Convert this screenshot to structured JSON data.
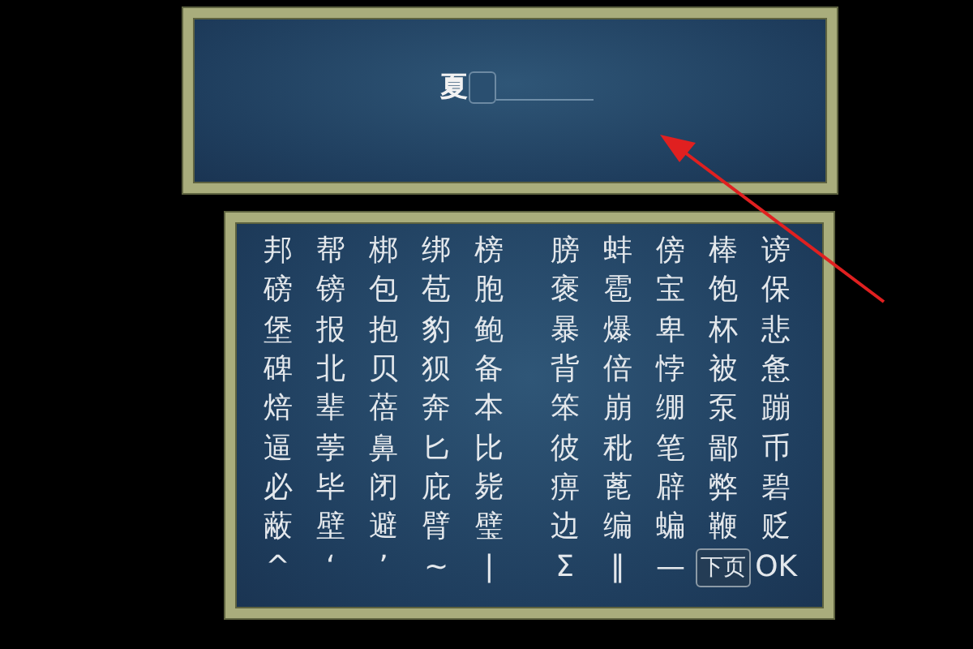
{
  "name_entry": {
    "value": "夏"
  },
  "keyboard": {
    "rows": [
      {
        "cells": [
          {
            "text": "邦",
            "selected": false
          },
          {
            "text": "帮",
            "selected": false
          },
          {
            "text": "梆",
            "selected": false
          },
          {
            "text": "绑",
            "selected": false
          },
          {
            "text": "榜",
            "selected": false
          },
          {
            "text": "膀",
            "selected": false
          },
          {
            "text": "蚌",
            "selected": false
          },
          {
            "text": "傍",
            "selected": false
          },
          {
            "text": "棒",
            "selected": false
          },
          {
            "text": "谤",
            "selected": false
          }
        ]
      },
      {
        "cells": [
          {
            "text": "磅",
            "selected": false
          },
          {
            "text": "镑",
            "selected": false
          },
          {
            "text": "包",
            "selected": false
          },
          {
            "text": "苞",
            "selected": false
          },
          {
            "text": "胞",
            "selected": false
          },
          {
            "text": "褒",
            "selected": false
          },
          {
            "text": "雹",
            "selected": false
          },
          {
            "text": "宝",
            "selected": false
          },
          {
            "text": "饱",
            "selected": false
          },
          {
            "text": "保",
            "selected": false
          }
        ]
      },
      {
        "cells": [
          {
            "text": "堡",
            "selected": false
          },
          {
            "text": "报",
            "selected": false
          },
          {
            "text": "抱",
            "selected": false
          },
          {
            "text": "豹",
            "selected": false
          },
          {
            "text": "鲍",
            "selected": false
          },
          {
            "text": "暴",
            "selected": false
          },
          {
            "text": "爆",
            "selected": false
          },
          {
            "text": "卑",
            "selected": false
          },
          {
            "text": "杯",
            "selected": false
          },
          {
            "text": "悲",
            "selected": false
          }
        ]
      },
      {
        "cells": [
          {
            "text": "碑",
            "selected": false
          },
          {
            "text": "北",
            "selected": false
          },
          {
            "text": "贝",
            "selected": false
          },
          {
            "text": "狈",
            "selected": false
          },
          {
            "text": "备",
            "selected": false
          },
          {
            "text": "背",
            "selected": false
          },
          {
            "text": "倍",
            "selected": false
          },
          {
            "text": "悖",
            "selected": false
          },
          {
            "text": "被",
            "selected": false
          },
          {
            "text": "惫",
            "selected": false
          }
        ]
      },
      {
        "cells": [
          {
            "text": "焙",
            "selected": false
          },
          {
            "text": "辈",
            "selected": false
          },
          {
            "text": "蓓",
            "selected": false
          },
          {
            "text": "奔",
            "selected": false
          },
          {
            "text": "本",
            "selected": false
          },
          {
            "text": "笨",
            "selected": false
          },
          {
            "text": "崩",
            "selected": false
          },
          {
            "text": "绷",
            "selected": false
          },
          {
            "text": "泵",
            "selected": false
          },
          {
            "text": "蹦",
            "selected": false
          }
        ]
      },
      {
        "cells": [
          {
            "text": "逼",
            "selected": false
          },
          {
            "text": "荸",
            "selected": false
          },
          {
            "text": "鼻",
            "selected": false
          },
          {
            "text": "匕",
            "selected": false
          },
          {
            "text": "比",
            "selected": false
          },
          {
            "text": "彼",
            "selected": false
          },
          {
            "text": "秕",
            "selected": false
          },
          {
            "text": "笔",
            "selected": false
          },
          {
            "text": "鄙",
            "selected": false
          },
          {
            "text": "币",
            "selected": false
          }
        ]
      },
      {
        "cells": [
          {
            "text": "必",
            "selected": false
          },
          {
            "text": "毕",
            "selected": false
          },
          {
            "text": "闭",
            "selected": false
          },
          {
            "text": "庇",
            "selected": false
          },
          {
            "text": "毙",
            "selected": false
          },
          {
            "text": "痹",
            "selected": false
          },
          {
            "text": "蓖",
            "selected": false
          },
          {
            "text": "辟",
            "selected": false
          },
          {
            "text": "弊",
            "selected": false
          },
          {
            "text": "碧",
            "selected": false
          }
        ]
      },
      {
        "cells": [
          {
            "text": "蔽",
            "selected": false
          },
          {
            "text": "壁",
            "selected": false
          },
          {
            "text": "避",
            "selected": false
          },
          {
            "text": "臂",
            "selected": false
          },
          {
            "text": "璧",
            "selected": false
          },
          {
            "text": "边",
            "selected": false
          },
          {
            "text": "编",
            "selected": false
          },
          {
            "text": "蝙",
            "selected": false
          },
          {
            "text": "鞭",
            "selected": false
          },
          {
            "text": "贬",
            "selected": false
          }
        ]
      },
      {
        "cells": [
          {
            "text": "^",
            "selected": false
          },
          {
            "text": "‘",
            "selected": false
          },
          {
            "text": "’",
            "selected": false
          },
          {
            "text": "~",
            "selected": false
          },
          {
            "text": "|",
            "selected": false
          },
          {
            "text": "Σ",
            "selected": false
          },
          {
            "text": "‖",
            "selected": false
          },
          {
            "text": "—",
            "selected": false
          },
          {
            "text": "下页",
            "selected": true
          },
          {
            "text": "OK",
            "selected": false
          }
        ]
      }
    ]
  }
}
